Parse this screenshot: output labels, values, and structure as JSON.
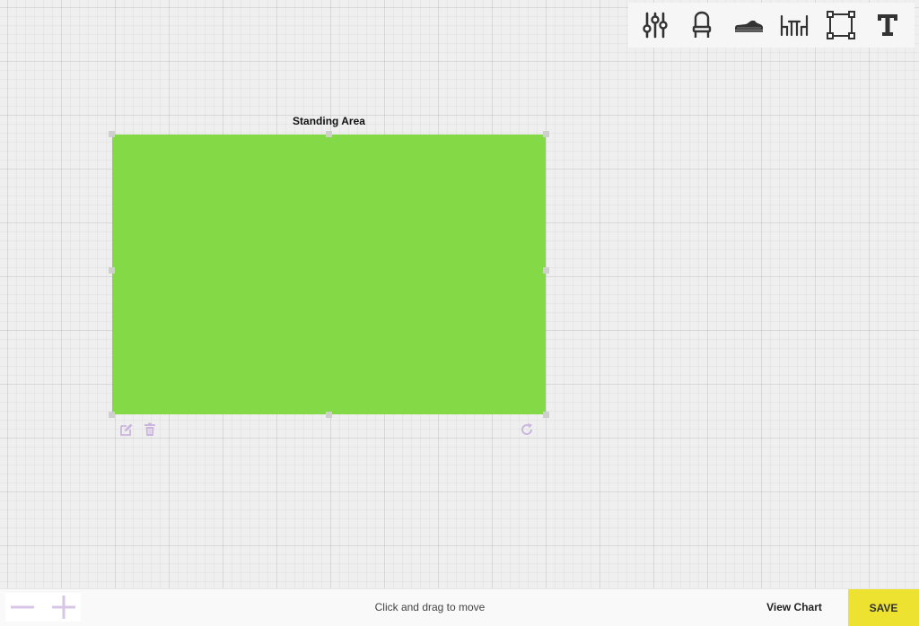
{
  "toolbar": {
    "icons": [
      "sliders-icon",
      "chair-icon",
      "shoe-icon",
      "table-icon",
      "selection-box-icon",
      "text-icon"
    ]
  },
  "area": {
    "label": "Standing Area",
    "fill_color": "#84d946",
    "action_icons": [
      "edit-icon",
      "trash-icon",
      "rotate-icon"
    ]
  },
  "footer": {
    "hint": "Click and drag to move",
    "view_chart_label": "View Chart",
    "save_label": "SAVE",
    "save_color": "#ede22f",
    "zoom_controls": [
      "zoom-out-icon",
      "zoom-in-icon"
    ]
  }
}
